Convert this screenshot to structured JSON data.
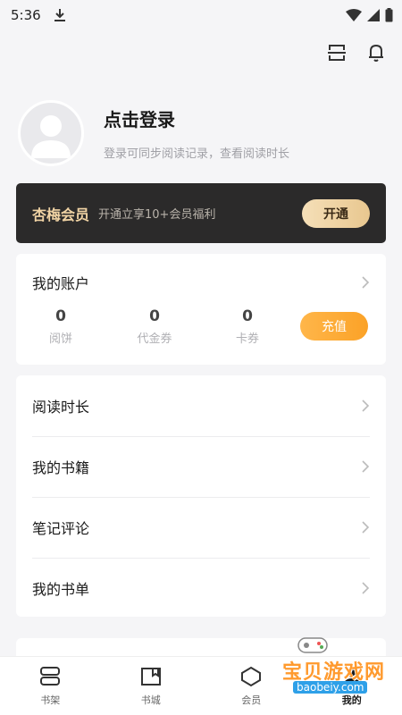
{
  "status_bar": {
    "time": "5:36"
  },
  "profile": {
    "title": "点击登录",
    "subtitle": "登录可同步阅读记录，查看阅读时长"
  },
  "vip": {
    "name": "杏梅会员",
    "desc": "开通立享10+会员福利",
    "button": "开通"
  },
  "account": {
    "title": "我的账户",
    "stats": [
      {
        "value": "0",
        "label": "阅饼"
      },
      {
        "value": "0",
        "label": "代金券"
      },
      {
        "value": "0",
        "label": "卡券"
      }
    ],
    "recharge": "充值"
  },
  "menu": [
    {
      "label": "阅读时长"
    },
    {
      "label": "我的书籍"
    },
    {
      "label": "笔记评论"
    },
    {
      "label": "我的书单"
    }
  ],
  "tabs": [
    {
      "label": "书架",
      "icon": "bookshelf-icon"
    },
    {
      "label": "书城",
      "icon": "bookstore-icon"
    },
    {
      "label": "会员",
      "icon": "vip-icon"
    },
    {
      "label": "我的",
      "icon": "profile-icon"
    }
  ],
  "watermark": {
    "text": "宝贝游戏网",
    "url": "baobeiy.com"
  },
  "colors": {
    "accent_orange": "#fba227",
    "vip_gold": "#f0d3a4",
    "vip_dark": "#2b2a2a",
    "background": "#f5f5f7"
  }
}
